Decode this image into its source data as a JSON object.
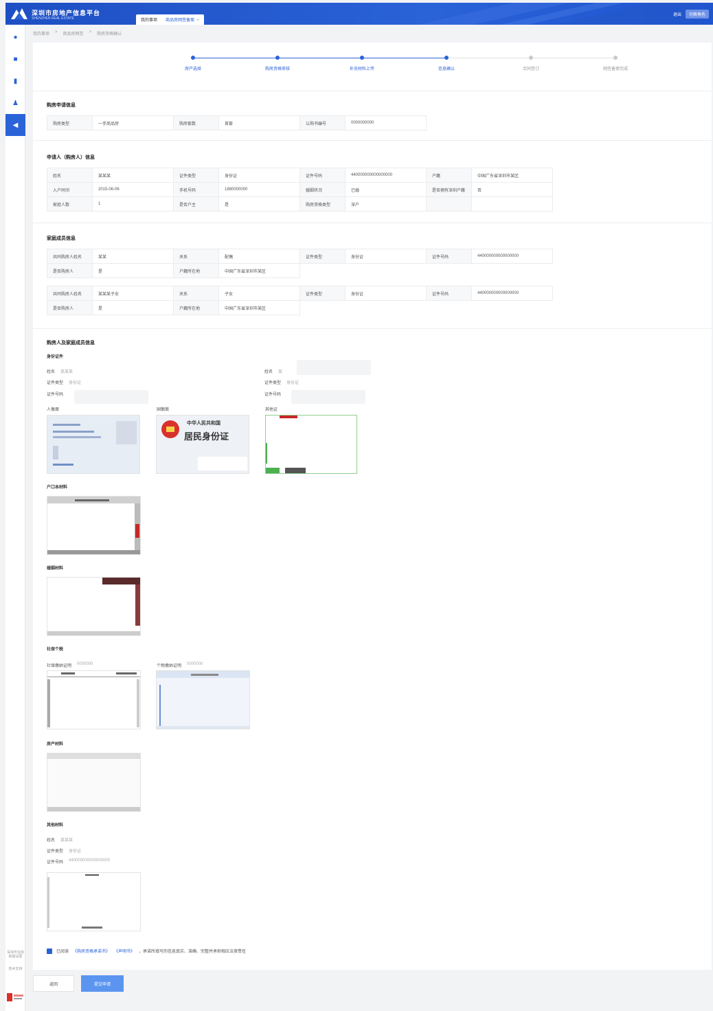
{
  "header": {
    "title": "深圳市房地产信息平台",
    "subtitle": "SHENZHEN REAL ESTATE",
    "tabs": [
      {
        "label": "我的事项"
      },
      {
        "label": "商品房网签备案"
      }
    ],
    "user": "退出",
    "action": "切换角色"
  },
  "sidebar": {
    "items": [
      {
        "icon": "home-icon"
      },
      {
        "icon": "calendar-icon"
      },
      {
        "icon": "document-icon"
      },
      {
        "icon": "user-icon"
      },
      {
        "icon": "send-icon"
      }
    ],
    "footer1": "深圳市住房和建设局",
    "footer2": "技术支持"
  },
  "breadcrumb": [
    "我的事项",
    "商品房网签",
    "购房资格确认"
  ],
  "stepper": {
    "steps": [
      {
        "label": "房产选择",
        "done": true
      },
      {
        "label": "购房资格审核",
        "done": true
      },
      {
        "label": "补充材料上传",
        "done": true
      },
      {
        "label": "信息确认",
        "done": true
      },
      {
        "label": "合同签订",
        "done": false
      },
      {
        "label": "网签备案完成",
        "done": false
      }
    ],
    "accent": "#2a62d8",
    "inactive": "#c9c9c9"
  },
  "sections": {
    "purchase": {
      "title": "购房申请信息",
      "rows": [
        [
          {
            "k": "购房类型",
            "v": "一手商品房"
          },
          {
            "k": "购房套数",
            "v": "首套"
          },
          {
            "k": "认购书编号",
            "v": "0000000000"
          }
        ]
      ]
    },
    "applicant": {
      "title": "申请人（购房人）信息",
      "rows": [
        [
          {
            "k": "姓名",
            "v": "某某某"
          },
          {
            "k": "证件类型",
            "v": "身份证"
          },
          {
            "k": "证件号码",
            "v": "440000000000000000"
          },
          {
            "k": "户籍",
            "v": "中国广东省深圳市某区"
          }
        ],
        [
          {
            "k": "入户时间",
            "v": "2015-06-06"
          },
          {
            "k": "手机号码",
            "v": "1880000000"
          },
          {
            "k": "婚姻状况",
            "v": "已婚"
          },
          {
            "k": "是否拥有深圳户籍",
            "v": "否"
          }
        ],
        [
          {
            "k": "家庭人数",
            "v": "1"
          },
          {
            "k": "是否户主",
            "v": "是"
          },
          {
            "k": "购房资格类型",
            "v": "深户"
          },
          {
            "k": "",
            "v": ""
          }
        ]
      ]
    },
    "family": {
      "title": "家庭成员信息",
      "groups": [
        [
          [
            {
              "k": "共同购房人姓名",
              "v": "某某"
            },
            {
              "k": "关系",
              "v": "配偶"
            },
            {
              "k": "证件类型",
              "v": "身份证"
            },
            {
              "k": "证件号码",
              "v": "440000000000000000"
            }
          ],
          [
            {
              "k": "是否购房人",
              "v": "是"
            },
            {
              "k": "户籍所在地",
              "v": "中国广东省深圳市某区"
            }
          ]
        ],
        [
          [
            {
              "k": "共同购房人姓名",
              "v": "某某某子女"
            },
            {
              "k": "关系",
              "v": "子女"
            },
            {
              "k": "证件类型",
              "v": "身份证"
            },
            {
              "k": "证件号码",
              "v": "440000000000000000"
            }
          ],
          [
            {
              "k": "是否购房人",
              "v": "是"
            },
            {
              "k": "户籍所在地",
              "v": "中国广东省深圳市某区"
            }
          ]
        ]
      ]
    },
    "materials": {
      "title": "购房人及家庭成员信息",
      "identity_title": "身份证件",
      "left": [
        {
          "k": "姓名",
          "v": "某某某"
        },
        {
          "k": "证件类型",
          "v": "身份证"
        },
        {
          "k": "证件号码",
          "v": ""
        }
      ],
      "right": [
        {
          "k": "姓名",
          "v": "某"
        },
        {
          "k": "证件类型",
          "v": "身份证"
        },
        {
          "k": "证件号码",
          "v": ""
        }
      ],
      "photo_labels": [
        "人像面",
        "国徽面",
        "其他证"
      ],
      "id_card_text": "中华人民共和国",
      "id_card_text2": "居民身份证",
      "hukou_title": "户口本材料",
      "marriage_title": "婚姻材料",
      "social_title": "社保个税",
      "social_left": {
        "k": "社保缴纳证明",
        "v": "0000000"
      },
      "social_right": {
        "k": "个税缴纳证明",
        "v": "0000000"
      },
      "house_title": "房产材料",
      "other_title": "其他材料",
      "other_fields": [
        {
          "k": "姓名",
          "v": "某某某"
        },
        {
          "k": "证件类型",
          "v": "身份证"
        },
        {
          "k": "证件号码",
          "v": "440000000000000000"
        }
      ]
    }
  },
  "agreement": {
    "prefix": "已阅读",
    "link1": "《购房资格承诺书》",
    "link2": "《声明书》",
    "suffix": "，承诺所填写的信息真实、准确、完整并承担相应法律责任"
  },
  "footer": {
    "back": "返回",
    "submit": "提交申请"
  }
}
